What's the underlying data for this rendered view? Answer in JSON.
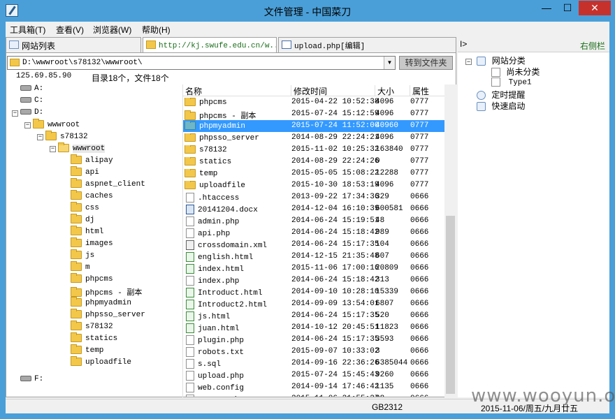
{
  "window": {
    "title": "文件管理 - 中国菜刀",
    "min": "—",
    "max": "☐",
    "close": "✕"
  },
  "menu": [
    {
      "label": "工具箱(T)"
    },
    {
      "label": "查看(V)"
    },
    {
      "label": "浏览器(W)"
    },
    {
      "label": "帮助(H)"
    }
  ],
  "tabs": [
    {
      "label": "网站列表"
    },
    {
      "label": "http://kj.swufe.edu.cn/w..."
    },
    {
      "label": "upload.php[编辑]"
    }
  ],
  "pathbar": {
    "value": "D:\\wwwroot\\s78132\\wwwroot\\",
    "goto_label": "转到文件夹"
  },
  "info": {
    "ip": "125.69.85.90",
    "count": "目录18个，文件18个"
  },
  "columns": {
    "name": "名称",
    "time": "修改时间",
    "size": "大小",
    "attr": "属性"
  },
  "tree": [
    {
      "label": "A:",
      "type": "drive"
    },
    {
      "label": "C:",
      "type": "drive"
    },
    {
      "label": "D:",
      "type": "drive"
    },
    {
      "label": "wwwroot",
      "type": "folder"
    },
    {
      "label": "s78132",
      "type": "folder"
    },
    {
      "label": "wwwroot",
      "type": "folder"
    },
    {
      "label": "alipay",
      "type": "folder"
    },
    {
      "label": "api",
      "type": "folder"
    },
    {
      "label": "aspnet_client",
      "type": "folder"
    },
    {
      "label": "caches",
      "type": "folder"
    },
    {
      "label": "css",
      "type": "folder"
    },
    {
      "label": "dj",
      "type": "folder"
    },
    {
      "label": "html",
      "type": "folder"
    },
    {
      "label": "images",
      "type": "folder"
    },
    {
      "label": "js",
      "type": "folder"
    },
    {
      "label": "m",
      "type": "folder"
    },
    {
      "label": "phpcms",
      "type": "folder"
    },
    {
      "label": "phpcms - 副本",
      "type": "folder"
    },
    {
      "label": "phpmyadmin",
      "type": "folder"
    },
    {
      "label": "phpsso_server",
      "type": "folder"
    },
    {
      "label": "s78132",
      "type": "folder"
    },
    {
      "label": "statics",
      "type": "folder"
    },
    {
      "label": "temp",
      "type": "folder"
    },
    {
      "label": "uploadfile",
      "type": "folder"
    },
    {
      "label": "F:",
      "type": "drive"
    }
  ],
  "files": [
    {
      "name": "phpcms",
      "time": "2015-04-22 10:52:38",
      "size": "4096",
      "attr": "0777",
      "icon": "folder"
    },
    {
      "name": "phpcms - 副本",
      "time": "2015-07-24 15:12:59",
      "size": "4096",
      "attr": "0777",
      "icon": "folder"
    },
    {
      "name": "phpmyadmin",
      "time": "2015-07-24 11:52:00",
      "size": "40960",
      "attr": "0777",
      "icon": "folder"
    },
    {
      "name": "phpsso_server",
      "time": "2014-08-29 22:24:21",
      "size": "4096",
      "attr": "0777",
      "icon": "folder"
    },
    {
      "name": "s78132",
      "time": "2015-11-02 10:25:32",
      "size": "163840",
      "attr": "0777",
      "icon": "folder"
    },
    {
      "name": "statics",
      "time": "2014-08-29 22:24:26",
      "size": "0",
      "attr": "0777",
      "icon": "folder"
    },
    {
      "name": "temp",
      "time": "2015-05-05 15:08:22",
      "size": "12288",
      "attr": "0777",
      "icon": "folder"
    },
    {
      "name": "uploadfile",
      "time": "2015-10-30 18:53:19",
      "size": "4096",
      "attr": "0777",
      "icon": "folder"
    },
    {
      "name": ".htaccess",
      "time": "2013-09-22 17:34:36",
      "size": "329",
      "attr": "0666",
      "icon": "file"
    },
    {
      "name": "20141204.docx",
      "time": "2014-12-04 16:10:39",
      "size": "600581",
      "attr": "0666",
      "icon": "word"
    },
    {
      "name": "admin.php",
      "time": "2014-06-24 15:19:51",
      "size": "48",
      "attr": "0666",
      "icon": "file"
    },
    {
      "name": "api.php",
      "time": "2014-06-24 15:18:42",
      "size": "989",
      "attr": "0666",
      "icon": "file"
    },
    {
      "name": "crossdomain.xml",
      "time": "2014-06-24 15:17:35",
      "size": "104",
      "attr": "0666",
      "icon": "xml"
    },
    {
      "name": "english.html",
      "time": "2014-12-15 21:35:48",
      "size": "607",
      "attr": "0666",
      "icon": "ie"
    },
    {
      "name": "index.html",
      "time": "2015-11-06 17:00:16",
      "size": "20809",
      "attr": "0666",
      "icon": "ie"
    },
    {
      "name": "index.php",
      "time": "2014-06-24 15:18:42",
      "size": "313",
      "attr": "0666",
      "icon": "file"
    },
    {
      "name": "Introduct.html",
      "time": "2014-09-10 10:28:10",
      "size": "15339",
      "attr": "0666",
      "icon": "ie"
    },
    {
      "name": "Introduct2.html",
      "time": "2014-09-09 13:54:01",
      "size": "6807",
      "attr": "0666",
      "icon": "ie"
    },
    {
      "name": "js.html",
      "time": "2014-06-24 15:17:35",
      "size": "520",
      "attr": "0666",
      "icon": "ie"
    },
    {
      "name": "juan.html",
      "time": "2014-10-12 20:45:51",
      "size": "11823",
      "attr": "0666",
      "icon": "ie"
    },
    {
      "name": "plugin.php",
      "time": "2014-06-24 15:17:35",
      "size": "3593",
      "attr": "0666",
      "icon": "file"
    },
    {
      "name": "robots.txt",
      "time": "2015-09-07 10:33:02",
      "size": "3",
      "attr": "0666",
      "icon": "file"
    },
    {
      "name": "s.sql",
      "time": "2014-09-16 22:36:26",
      "size": "6385044",
      "attr": "0666",
      "icon": "file"
    },
    {
      "name": "upload.php",
      "time": "2015-07-24 15:45:43",
      "size": "9260",
      "attr": "0666",
      "icon": "file"
    },
    {
      "name": "web.config",
      "time": "2014-09-14 17:46:42",
      "size": "1135",
      "attr": "0666",
      "icon": "file"
    },
    {
      "name": "wooyun.php",
      "time": "2015-11-06 21:55:27",
      "size": "98",
      "attr": "0666",
      "icon": "file"
    }
  ],
  "side": {
    "toggle": "I>",
    "label": "右侧栏",
    "items": [
      {
        "label": "网站分类"
      },
      {
        "label": "尚未分类"
      },
      {
        "label": "Type1"
      },
      {
        "label": "定时提醒"
      },
      {
        "label": "快速启动"
      }
    ]
  },
  "status": {
    "encoding": "GB2312",
    "date": "2015-11-06/周五/九月廿五"
  },
  "watermark": "www.wooyun.org"
}
